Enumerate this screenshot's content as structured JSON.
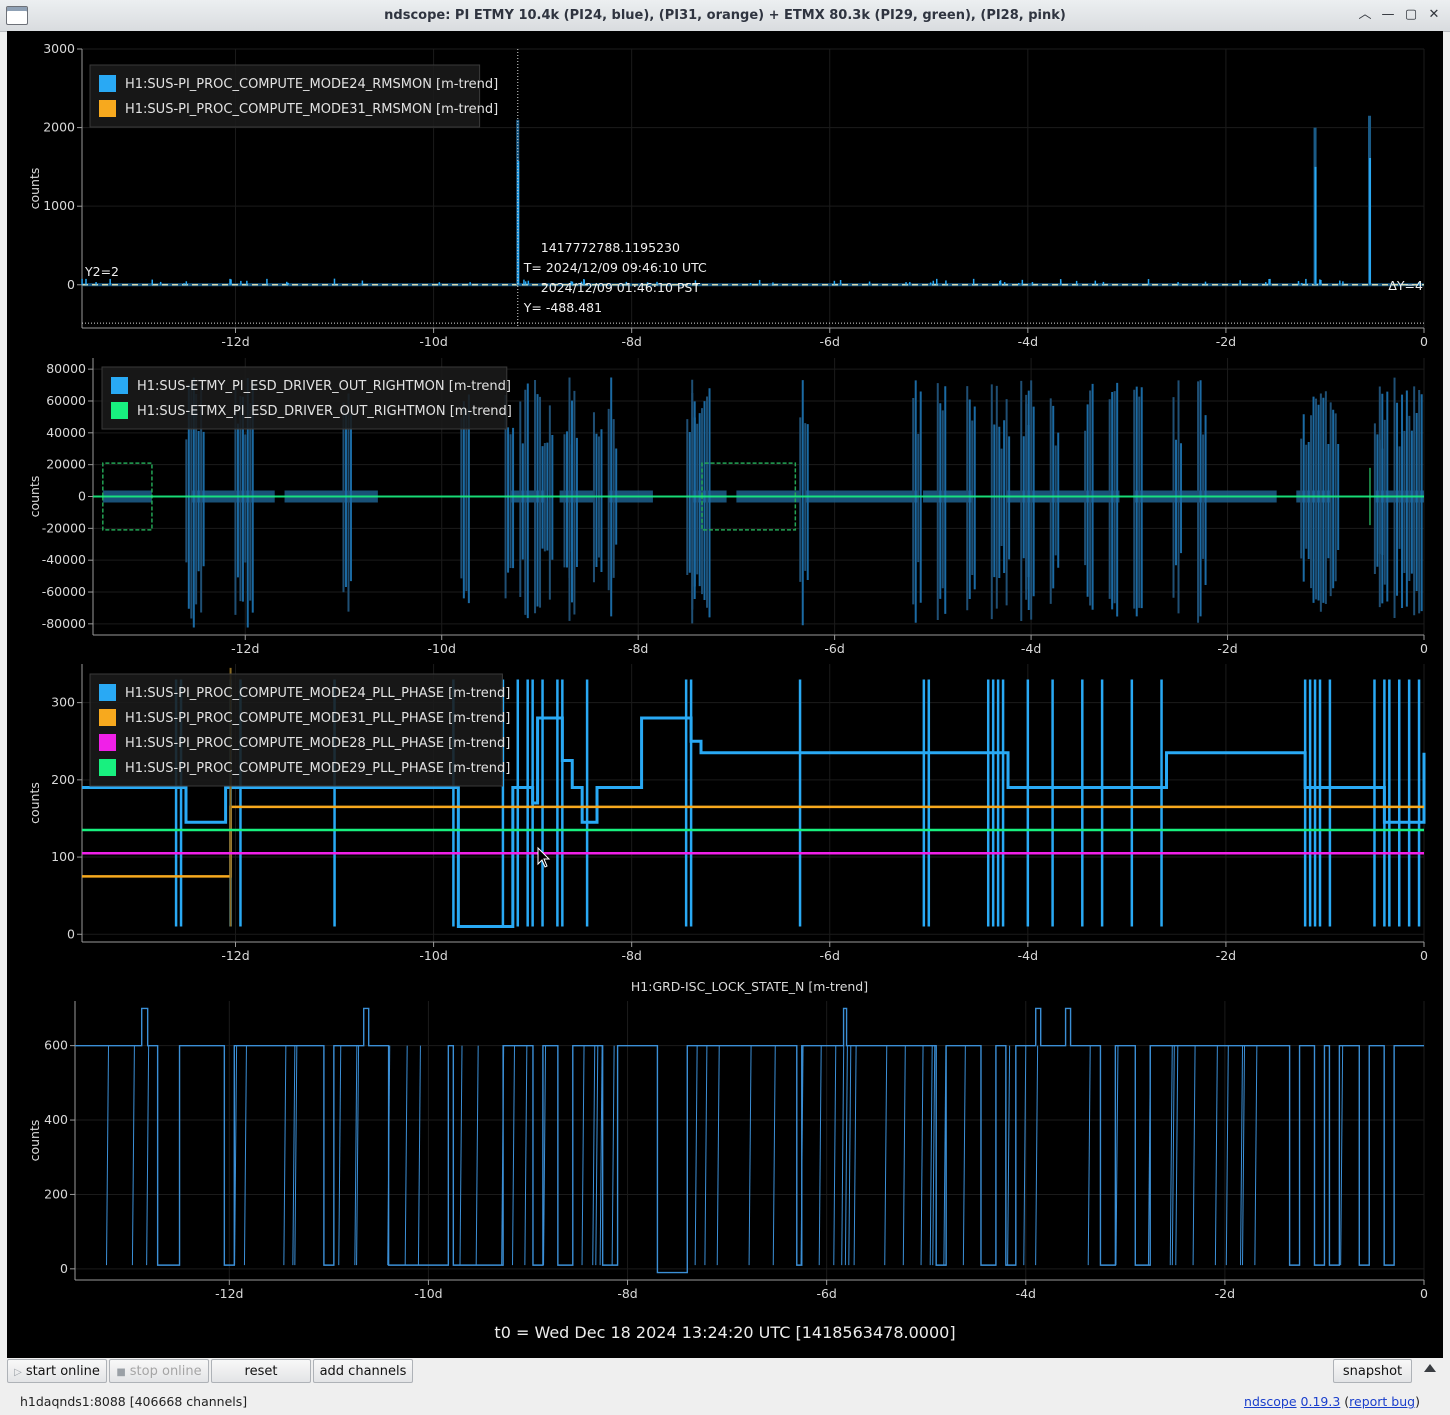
{
  "window": {
    "title": "ndscope: PI ETMY 10.4k (PI24, blue), (PI31, orange) + ETMX 80.3k (PI29, green), (PI28, pink)",
    "controls": [
      "minimize",
      "maximize",
      "close",
      "keep-above"
    ]
  },
  "colors": {
    "blue": "#29a9f4",
    "orange": "#f7a91e",
    "green": "#18f07f",
    "pink": "#f020e8",
    "dim_blue": "#1b5b86",
    "lock_line": "#3b8fd6"
  },
  "x_axis": {
    "range_days": [
      -13.55,
      0
    ],
    "ticks": [
      {
        "label": "-12d",
        "value": -12
      },
      {
        "label": "-10d",
        "value": -10
      },
      {
        "label": "-8d",
        "value": -8
      },
      {
        "label": "-6d",
        "value": -6
      },
      {
        "label": "-4d",
        "value": -4
      },
      {
        "label": "-2d",
        "value": -2
      },
      {
        "label": "0",
        "value": 0
      }
    ]
  },
  "plots": [
    {
      "id": "rmsmon",
      "ylabel": "counts",
      "y_ticks": [
        "3000",
        "2000",
        "1000",
        "0"
      ],
      "y_range": [
        -550,
        3000
      ],
      "legend": [
        {
          "label": "H1:SUS-PI_PROC_COMPUTE_MODE24_RMSMON [m-trend]",
          "color": "#29a9f4"
        },
        {
          "label": "H1:SUS-PI_PROC_COMPUTE_MODE31_RMSMON [m-trend]",
          "color": "#f7a91e"
        }
      ],
      "cursor": {
        "gps": "1417772788.1195230",
        "t_utc": "T= 2024/12/09 09:46:10 UTC",
        "t_pst": "2024/12/09 01:46:10 PST",
        "y": "Y= -488.481",
        "x_day": -9.15
      },
      "y2_label": "Y2=2",
      "dy_label": "ΔY=4",
      "spikes": [
        {
          "x": -9.15,
          "value": 2100
        },
        {
          "x": -1.1,
          "value": 2000
        },
        {
          "x": -0.55,
          "value": 2150
        }
      ]
    },
    {
      "id": "esd",
      "ylabel": "counts",
      "y_ticks": [
        "80000",
        "60000",
        "40000",
        "20000",
        "0",
        "-20000",
        "-40000",
        "-60000",
        "-80000"
      ],
      "y_range": [
        -87000,
        87000
      ],
      "legend": [
        {
          "label": "H1:SUS-ETMY_PI_ESD_DRIVER_OUT_RIGHTMON [m-trend]",
          "color": "#29a9f4"
        },
        {
          "label": "H1:SUS-ETMX_PI_ESD_DRIVER_OUT_RIGHTMON [m-trend]",
          "color": "#18f07f"
        }
      ]
    },
    {
      "id": "pll",
      "ylabel": "counts",
      "y_ticks": [
        "300",
        "200",
        "100",
        "0"
      ],
      "y_range": [
        -10,
        350
      ],
      "legend": [
        {
          "label": "H1:SUS-PI_PROC_COMPUTE_MODE24_PLL_PHASE [m-trend]",
          "color": "#29a9f4"
        },
        {
          "label": "H1:SUS-PI_PROC_COMPUTE_MODE31_PLL_PHASE [m-trend]",
          "color": "#f7a91e"
        },
        {
          "label": "H1:SUS-PI_PROC_COMPUTE_MODE28_PLL_PHASE [m-trend]",
          "color": "#f020e8"
        },
        {
          "label": "H1:SUS-PI_PROC_COMPUTE_MODE29_PLL_PHASE [m-trend]",
          "color": "#18f07f"
        }
      ],
      "levels": {
        "mode31_before": 75,
        "mode31_after": 165,
        "mode28": 105,
        "mode29": 135
      }
    },
    {
      "id": "lock",
      "title": "H1:GRD-ISC_LOCK_STATE_N [m-trend]",
      "ylabel": "counts",
      "y_ticks": [
        "600",
        "400",
        "200",
        "0"
      ],
      "y_range": [
        -30,
        720
      ]
    }
  ],
  "t0": "t0 = Wed Dec 18 2024 13:24:20 UTC [1418563478.0000]",
  "buttons": {
    "start_online": "start online",
    "stop_online": "stop online",
    "reset": "reset",
    "add_channels": "add channels",
    "snapshot": "snapshot"
  },
  "status": {
    "server": "h1daqnds1:8088  [406668 channels]",
    "app_name": "ndscope",
    "version": "0.19.3",
    "report_bug": "report bug"
  }
}
